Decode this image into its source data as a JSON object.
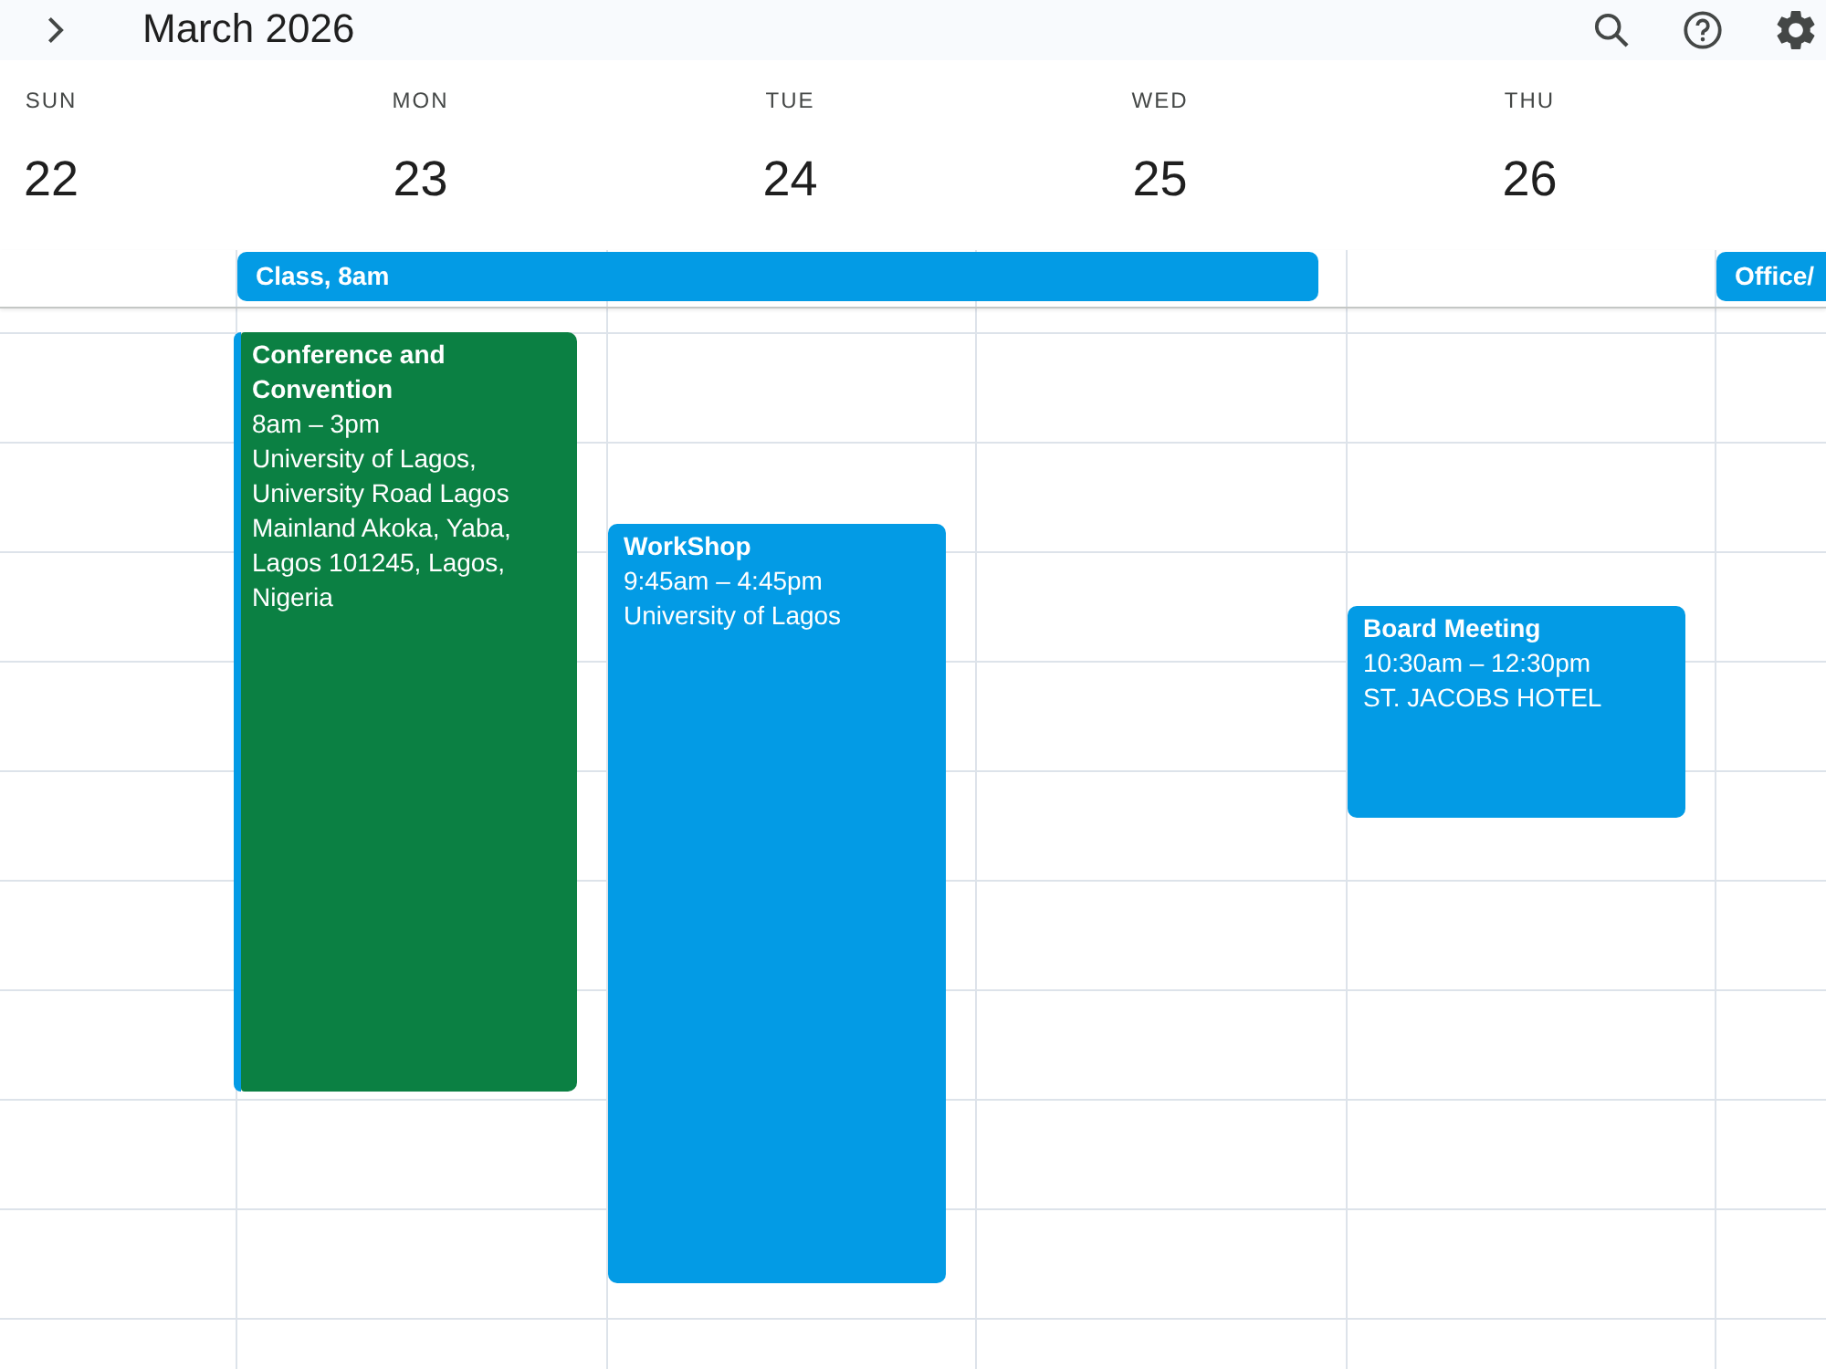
{
  "top_bar": {
    "title": "March 2026"
  },
  "days": [
    {
      "name": "SUN",
      "date": "22"
    },
    {
      "name": "MON",
      "date": "23",
      "all_day": {
        "kind": "start",
        "title": "Class, 8am"
      },
      "events": [
        {
          "title": "Conference and Convention",
          "time": "8am – 3pm",
          "location": "University of Lagos, University Road Lagos Mainland Akoka, Yaba, Lagos 101245, Lagos, Nigeria",
          "color": "#0b8043",
          "behind": {
            "color": "#039be5"
          }
        }
      ]
    },
    {
      "name": "TUE",
      "date": "24",
      "all_day": {
        "kind": "middle"
      },
      "events": [
        {
          "title": "WorkShop",
          "time": "9:45am – 4:45pm",
          "location": "University of Lagos",
          "color": "#039be5"
        }
      ]
    },
    {
      "name": "WED",
      "date": "25",
      "all_day": {
        "kind": "end"
      }
    },
    {
      "name": "THU",
      "date": "26",
      "events": [
        {
          "title": "Board Meeting",
          "time": "10:30am – 12:30pm",
          "location": "ST. JACOBS HOTEL",
          "color": "#039be5"
        }
      ]
    },
    {
      "all_day": {
        "kind": "start",
        "title": "Office/"
      }
    }
  ]
}
